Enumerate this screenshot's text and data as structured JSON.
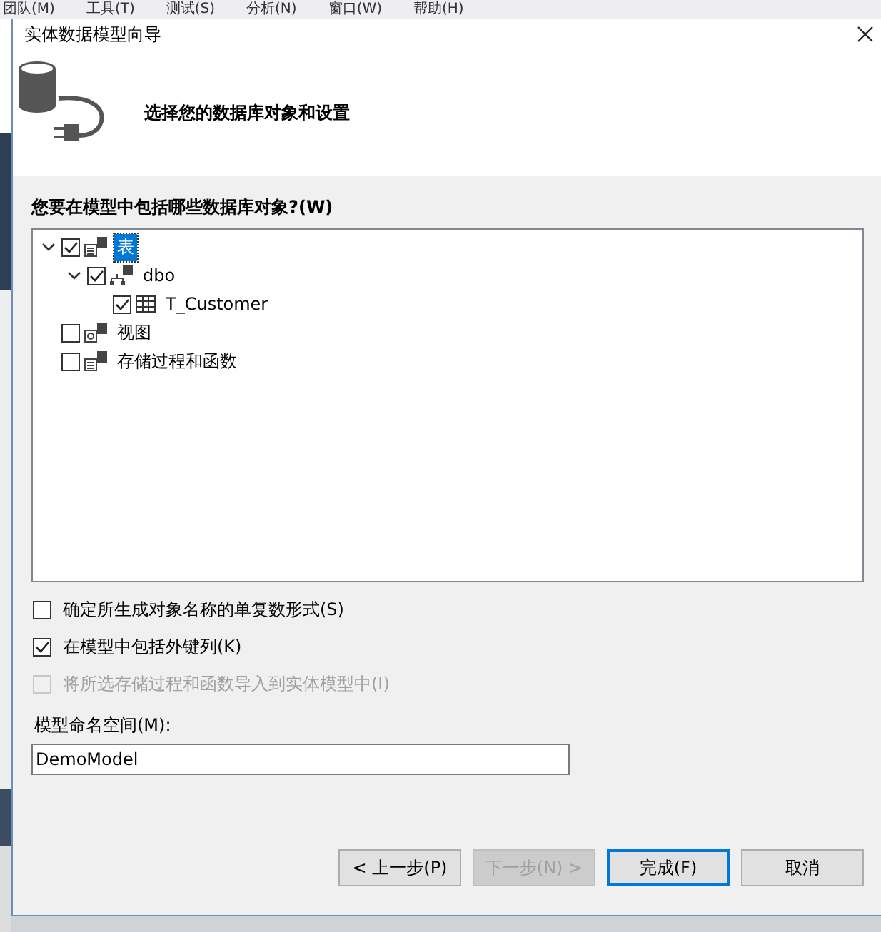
{
  "menu_bar": [
    "团队(M)",
    "工具(T)",
    "测试(S)",
    "分析(N)",
    "窗口(W)",
    "帮助(H)"
  ],
  "window": {
    "title": "实体数据模型向导",
    "heading": "选择您的数据库对象和设置"
  },
  "tree": {
    "label": "您要在模型中包括哪些数据库对象?(W)",
    "items": [
      {
        "label": "表",
        "kind": "tables",
        "checked": true,
        "selected": true,
        "expanded": true,
        "children": [
          {
            "label": "dbo",
            "kind": "schema",
            "checked": true,
            "selected": false,
            "expanded": true,
            "children": [
              {
                "label": "T_Customer",
                "kind": "table",
                "checked": true,
                "selected": false
              }
            ]
          }
        ]
      },
      {
        "label": "视图",
        "kind": "views",
        "checked": false,
        "selected": false
      },
      {
        "label": "存储过程和函数",
        "kind": "procs",
        "checked": false,
        "selected": false
      }
    ]
  },
  "options": [
    {
      "label": "确定所生成对象名称的单复数形式(S)",
      "checked": false,
      "disabled": false
    },
    {
      "label": "在模型中包括外键列(K)",
      "checked": true,
      "disabled": false
    },
    {
      "label": "将所选存储过程和函数导入到实体模型中(I)",
      "checked": false,
      "disabled": true
    }
  ],
  "namespace": {
    "label": "模型命名空间(M):",
    "value": "DemoModel"
  },
  "buttons": [
    {
      "label": "< 上一步(P)",
      "disabled": false,
      "default": false
    },
    {
      "label": "下一步(N) >",
      "disabled": true,
      "default": false
    },
    {
      "label": "完成(F)",
      "disabled": false,
      "default": true
    },
    {
      "label": "取消",
      "disabled": false,
      "default": false
    }
  ]
}
